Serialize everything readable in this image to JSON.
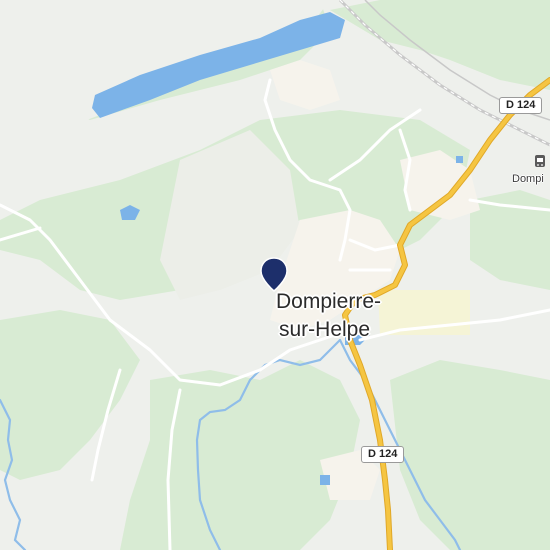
{
  "map": {
    "place_name_line1": "Dompierre-",
    "place_name_line2": "sur-Helpe",
    "road_shields": [
      "D 124",
      "D 124"
    ],
    "poi_label": "Dompi",
    "marker_icon": "location-pin-icon",
    "poi_icon": "train-station-icon",
    "colors": {
      "land": "#eef0ec",
      "forest": "#d8ebd3",
      "water": "#7cb3e8",
      "river": "#8fbde9",
      "road_main": "#f5c542",
      "road_main_casing": "#e0a828",
      "road_minor": "#ffffff",
      "urban": "#f6f3ec",
      "industrial": "#f6f5d8",
      "marker": "#1d2f6b"
    }
  }
}
